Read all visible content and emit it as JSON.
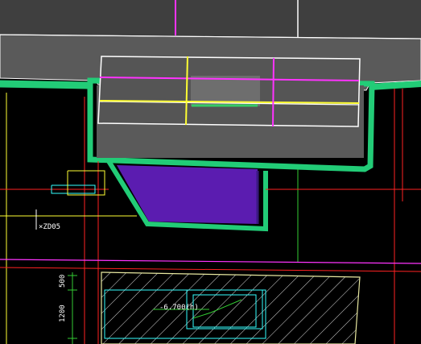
{
  "canvas": {
    "background": "#000000",
    "colors": {
      "slab": "#5a5a5a",
      "slab_dark": "#4a4a4a",
      "edge_white": "#ffffff",
      "magenta": "#ff33ff",
      "yellow": "#ffff33",
      "green_wall": "#22cc77",
      "green_line": "#33cc33",
      "purple_fill": "#5b1cb0",
      "cyan": "#33ffff",
      "red": "#ff2222",
      "hatch": "#dddddd",
      "hatch_border": "#e8e8a0"
    }
  },
  "labels": {
    "tag_zd05": "×ZD05",
    "level_mark": "-6.700(h)",
    "dim_500": "500",
    "dim_1200": "1200"
  }
}
